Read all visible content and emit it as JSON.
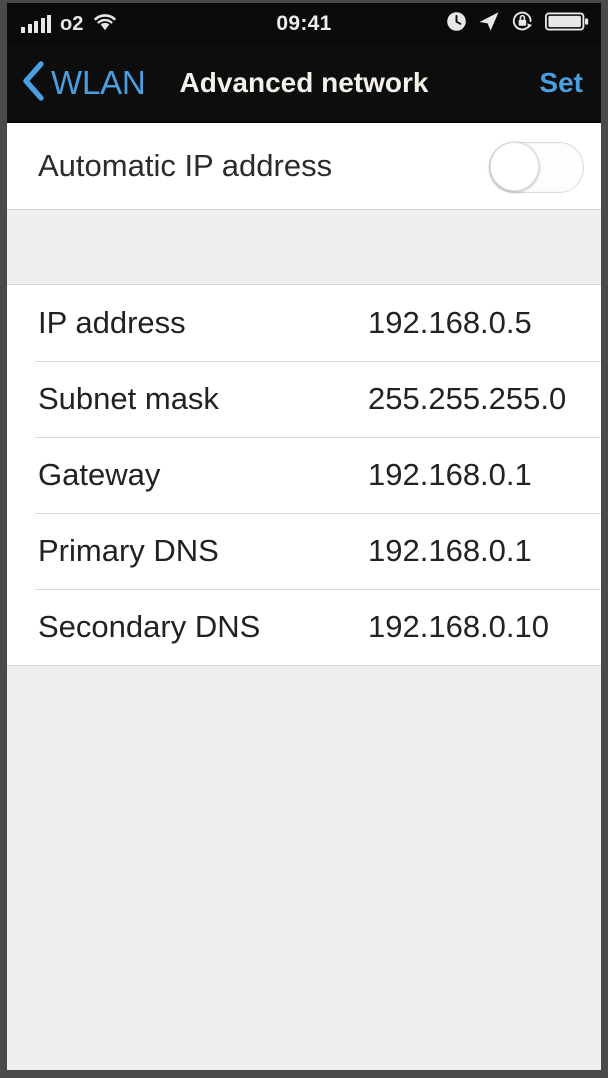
{
  "status_bar": {
    "carrier": "o2",
    "signal_icon": "signal-bars-icon",
    "wifi_icon": "wifi-icon",
    "time": "09:41",
    "alarm_icon": "alarm-clock-icon",
    "location_icon": "location-arrow-icon",
    "rotation_lock_icon": "rotation-lock-icon",
    "battery_icon": "battery-icon"
  },
  "nav_bar": {
    "back_icon": "chevron-left-icon",
    "back_label": "WLAN",
    "title": "Advanced network",
    "action_label": "Set",
    "accent_color": "#4a9fe0",
    "title_color": "#f4f1ea",
    "background_color": "#0d0d0d"
  },
  "settings": {
    "auto_ip": {
      "label": "Automatic IP address",
      "toggle_state": "off"
    },
    "network_fields": [
      {
        "label": "IP address",
        "value": "192.168.0.5"
      },
      {
        "label": "Subnet mask",
        "value": "255.255.255.0"
      },
      {
        "label": "Gateway",
        "value": "192.168.0.1"
      },
      {
        "label": "Primary DNS",
        "value": "192.168.0.1"
      },
      {
        "label": "Secondary DNS",
        "value": "192.168.0.10"
      }
    ]
  },
  "theme": {
    "page_background": "#efefed",
    "row_background": "#ffffff",
    "separator_color": "#d9d9d9",
    "text_color": "#222222"
  }
}
